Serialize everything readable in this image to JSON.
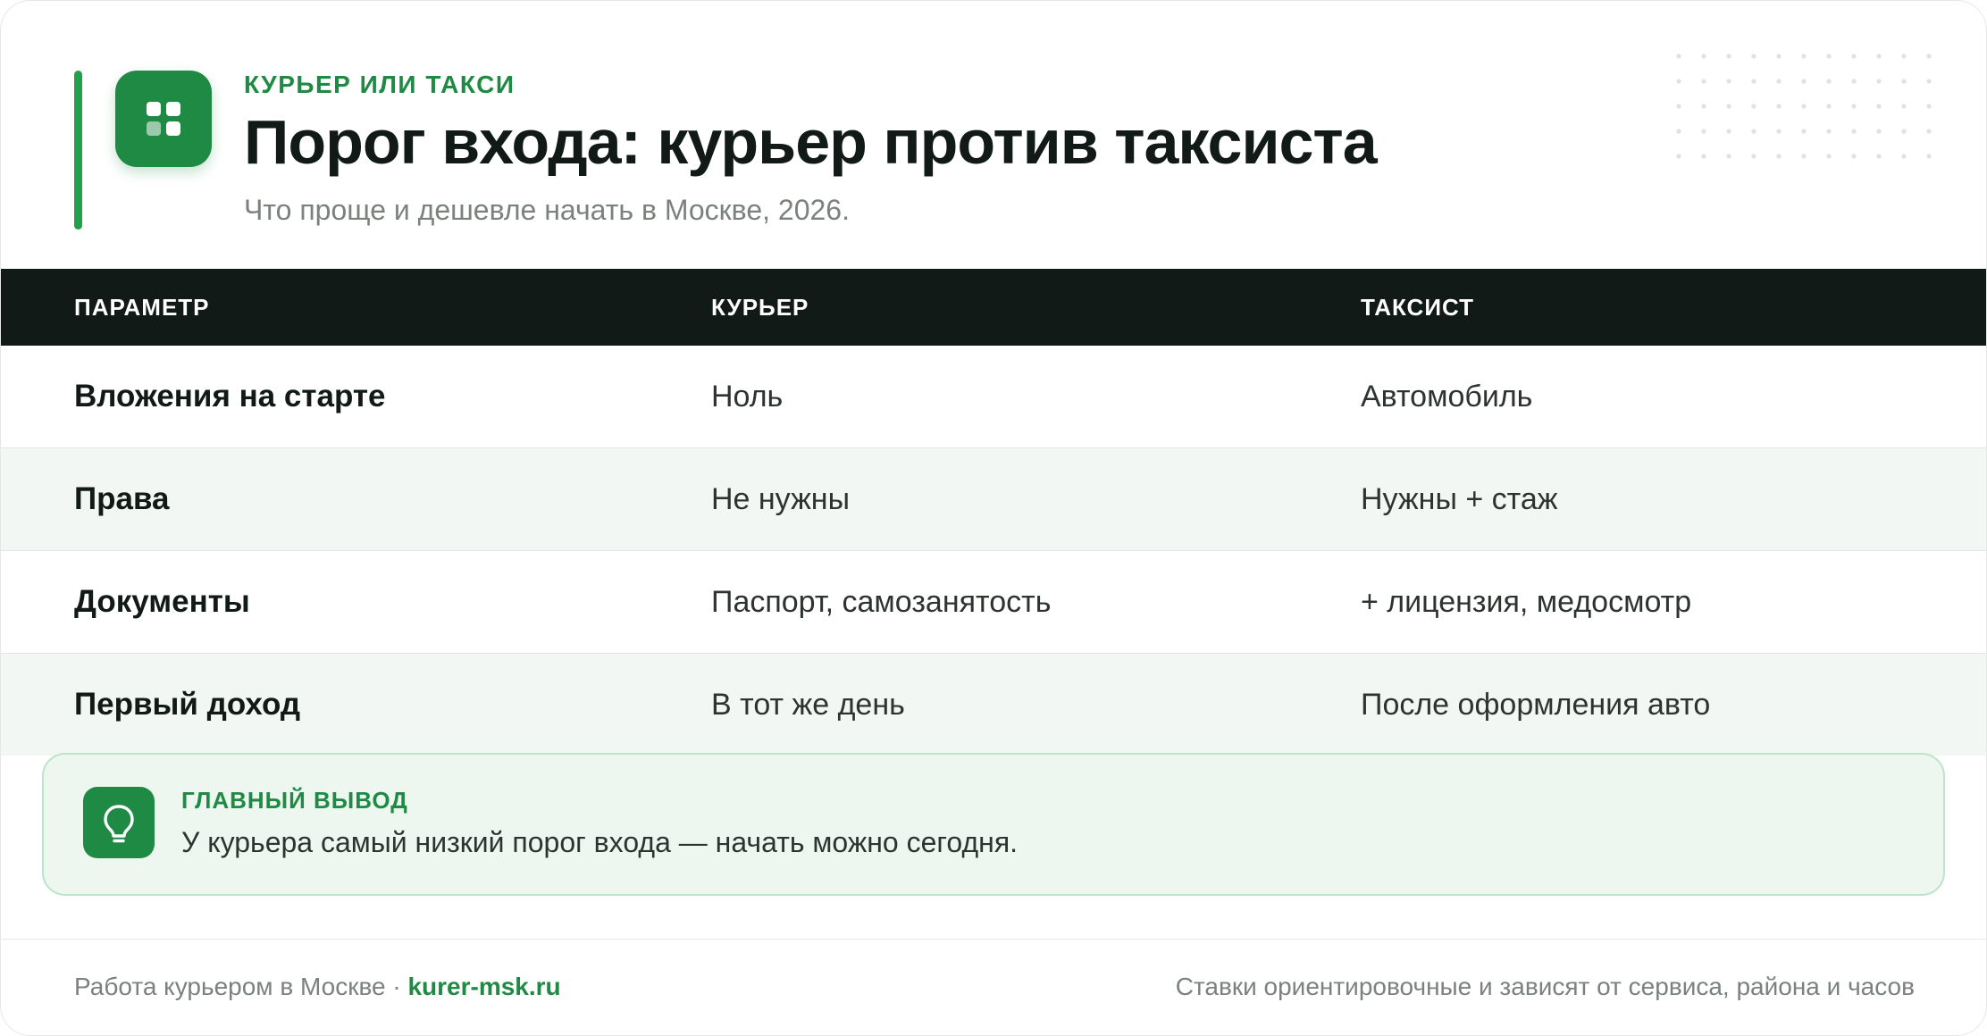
{
  "header": {
    "kicker": "КУРЬЕР ИЛИ ТАКСИ",
    "title": "Порог входа: курьер против таксиста",
    "subtitle": "Что проще и дешевле начать в Москве, 2026.",
    "logo_icon": "grid-icon"
  },
  "table": {
    "columns": [
      "ПАРАМЕТР",
      "КУРЬЕР",
      "ТАКСИСТ"
    ],
    "rows": [
      {
        "param": "Вложения на старте",
        "courier": "Ноль",
        "taxi": "Автомобиль"
      },
      {
        "param": "Права",
        "courier": "Не нужны",
        "taxi": "Нужны + стаж"
      },
      {
        "param": "Документы",
        "courier": "Паспорт, самозанятость",
        "taxi": "+ лицензия, медосмотр"
      },
      {
        "param": "Первый доход",
        "courier": "В тот же день",
        "taxi": "После оформления авто"
      }
    ]
  },
  "conclusion": {
    "icon": "lightbulb-icon",
    "label": "ГЛАВНЫЙ ВЫВОД",
    "text": "У курьера самый низкий порог входа — начать можно сегодня."
  },
  "footer": {
    "left_text": "Работа курьером в Москве · ",
    "site": "kurer-msk.ru",
    "right_text": "Ставки ориентировочные и зависят от сервиса, района и часов"
  },
  "colors": {
    "accent": "#1f8a43",
    "accent_bar": "#22a04b",
    "header_bg": "#111a16",
    "alt_row_bg": "#f3f7f4",
    "conclusion_bg": "#edf7f0"
  }
}
